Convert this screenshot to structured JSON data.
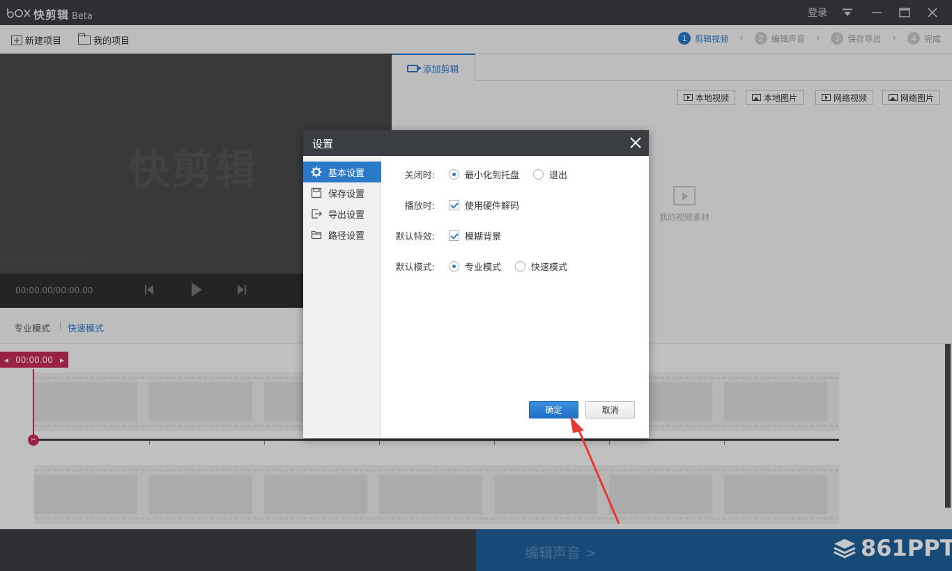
{
  "app": {
    "title": "快剪辑",
    "beta": "Beta"
  },
  "window": {
    "login": "登录"
  },
  "toolbar": {
    "new_project": "新建项目",
    "my_projects": "我的项目"
  },
  "steps": [
    {
      "num": "1",
      "label": "剪辑视频",
      "active": true
    },
    {
      "num": "2",
      "label": "编辑声音",
      "active": false
    },
    {
      "num": "3",
      "label": "保存导出",
      "active": false
    },
    {
      "num": "4",
      "label": "完成",
      "active": false
    }
  ],
  "preview": {
    "watermark": "快剪辑",
    "time": "00:00.00/00:00.00"
  },
  "right_panel": {
    "tab": "添加剪辑",
    "buttons": [
      "本地视频",
      "本地图片",
      "网络视频",
      "网络图片"
    ],
    "material_label": "我的视频素材"
  },
  "modes": {
    "pro": "专业模式",
    "fast": "快速模式"
  },
  "timeline": {
    "playhead_time": "00:00.00"
  },
  "bottom": {
    "next": "编辑声音 >",
    "brand": "861PPT"
  },
  "dialog": {
    "title": "设置",
    "sidebar": [
      "基本设置",
      "保存设置",
      "导出设置",
      "路径设置"
    ],
    "rows": {
      "close": {
        "label": "关闭时:",
        "opt1": "最小化到托盘",
        "opt2": "退出"
      },
      "play": {
        "label": "播放时:",
        "opt1": "使用硬件解码"
      },
      "effect": {
        "label": "默认特效:",
        "opt1": "模糊背景"
      },
      "mode": {
        "label": "默认模式:",
        "opt1": "专业模式",
        "opt2": "快速模式"
      }
    },
    "ok": "确定",
    "cancel": "取消"
  },
  "colors": {
    "accent": "#2b79c9",
    "playhead": "#c52c55",
    "annotation_arrow": "#e53935"
  }
}
